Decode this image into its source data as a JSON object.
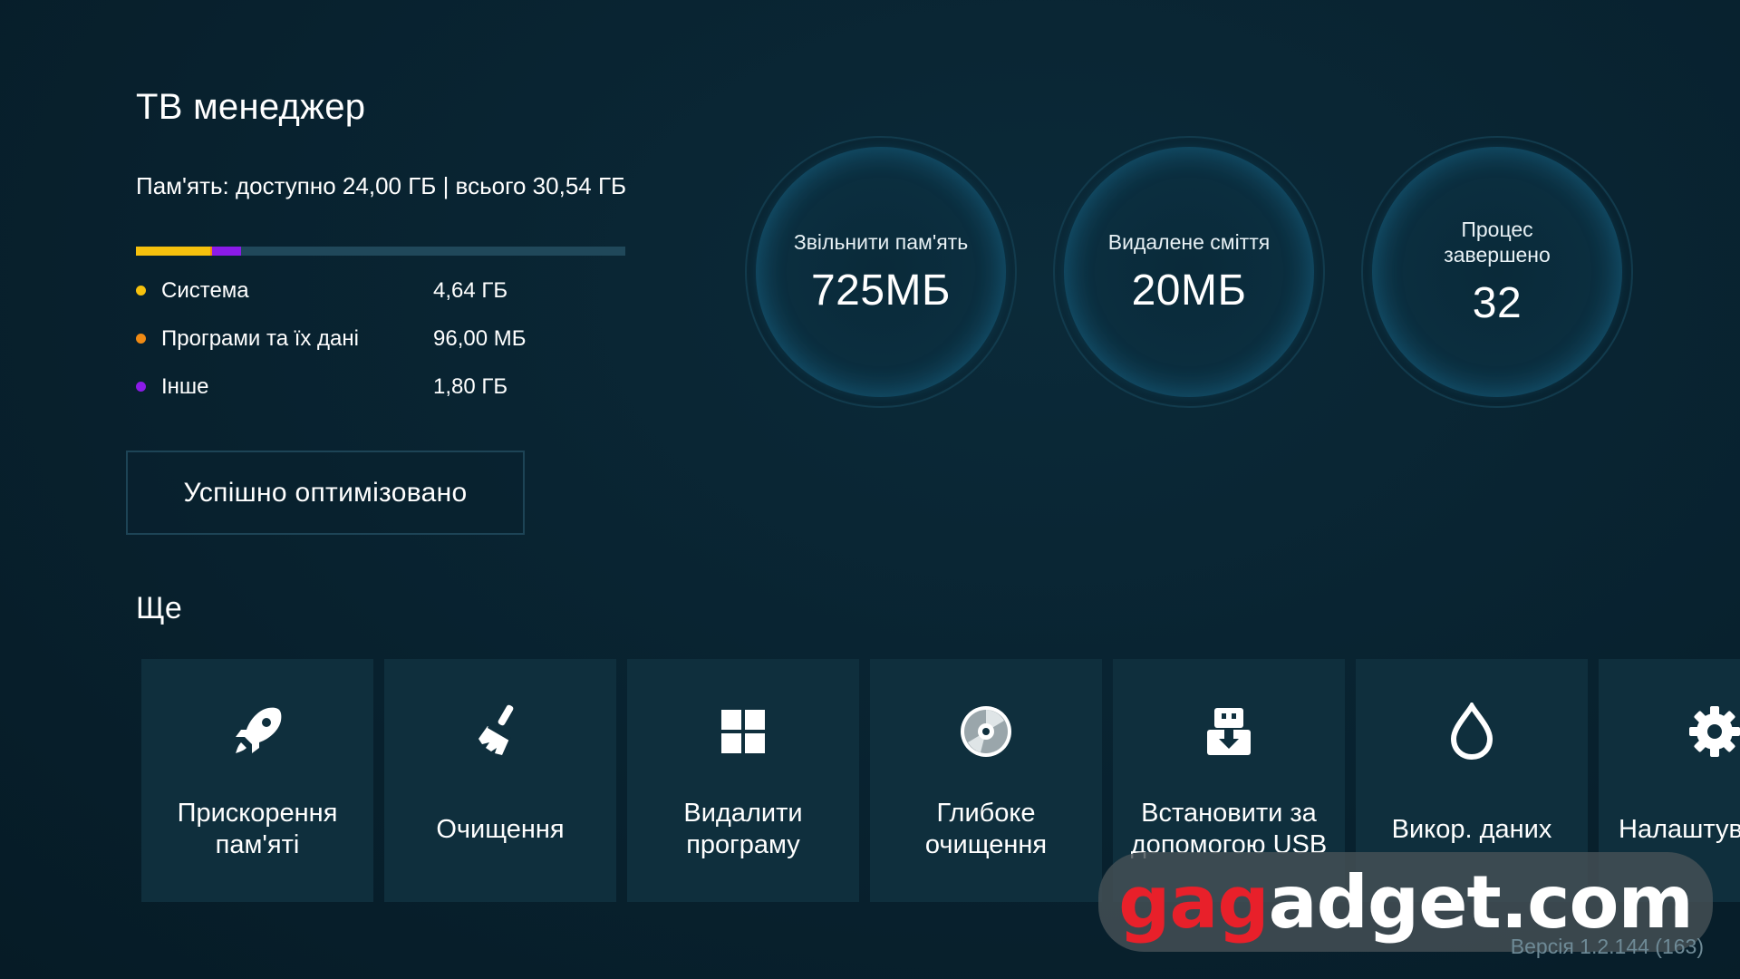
{
  "app": {
    "title": "ТВ менеджер",
    "version": "Версія 1.2.144 (163)"
  },
  "memory": {
    "summary": "Пам'ять: доступно 24,00 ГБ | всього 30,54 ГБ",
    "bar": [
      {
        "name": "Система",
        "fraction": 0.152,
        "color": "#f6c10d"
      },
      {
        "name": "Програми та їх дані",
        "fraction": 0.003,
        "color": "#f08a14"
      },
      {
        "name": "Інше",
        "fraction": 0.059,
        "color": "#8b1be8"
      }
    ],
    "bar_track_color": "#20485a",
    "legend": [
      {
        "label": "Система",
        "value": "4,64 ГБ",
        "color": "#f6c10d"
      },
      {
        "label": "Програми та їх дані",
        "value": "96,00 МБ",
        "color": "#f08a14"
      },
      {
        "label": "Інше",
        "value": "1,80 ГБ",
        "color": "#8b1be8"
      }
    ]
  },
  "status_button": {
    "label": "Успішно оптимізовано"
  },
  "stats": [
    {
      "label": "Звільнити пам'ять",
      "value": "725МБ"
    },
    {
      "label": "Видалене сміття",
      "value": "20МБ"
    },
    {
      "label": "Процес завершено",
      "value": "32"
    }
  ],
  "more": {
    "title": "Ще",
    "tiles": [
      {
        "label": "Прискорення пам'яті",
        "icon": "rocket-icon"
      },
      {
        "label": "Очищення",
        "icon": "broom-icon"
      },
      {
        "label": "Видалити програму",
        "icon": "apps-grid-icon"
      },
      {
        "label": "Глибоке очищення",
        "icon": "disc-icon"
      },
      {
        "label": "Встановити за допомогою USB",
        "icon": "usb-install-icon"
      },
      {
        "label": "Викор. даних",
        "icon": "drop-icon"
      },
      {
        "label": "Налаштування",
        "icon": "gear-icon"
      }
    ]
  },
  "watermark": {
    "red_part": "gag",
    "white_part": "adget.com"
  }
}
